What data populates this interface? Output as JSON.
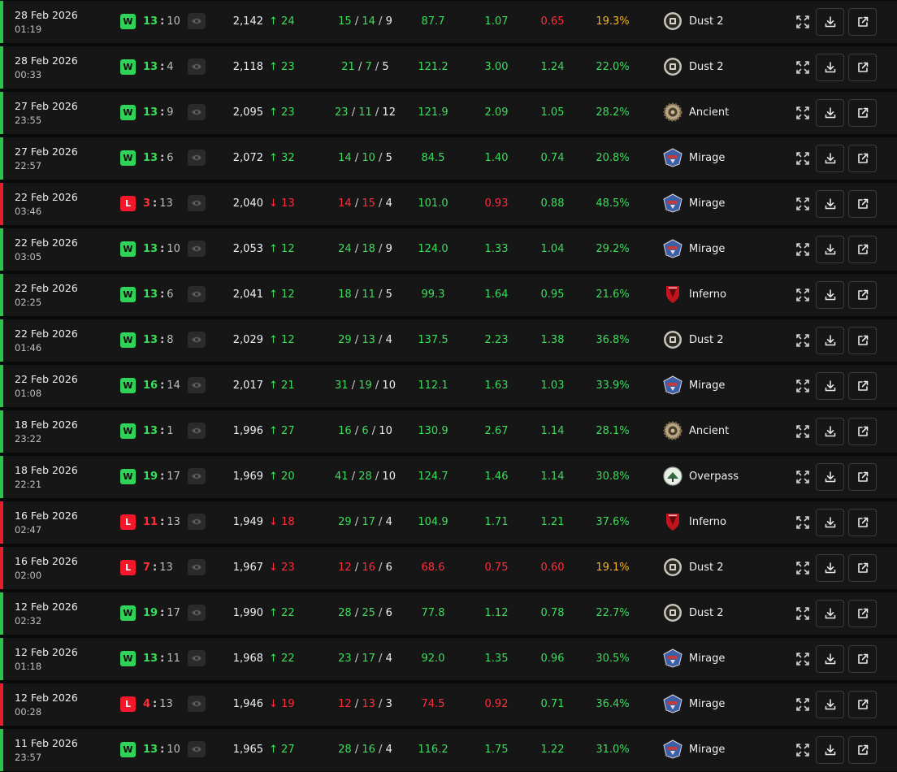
{
  "colors": {
    "win": "#2cc34c",
    "loss": "#e5202c",
    "green_text": "#3ddc5c",
    "red_text": "#ff2d3a",
    "yellow_text": "#f5b51e"
  },
  "matches": [
    {
      "date": "28 Feb 2026",
      "time": "01:19",
      "result": "W",
      "own": "13",
      "opp": "10",
      "elo": "2,142",
      "dir": "up",
      "change": "24",
      "kills": "15",
      "deaths": "14",
      "assists": "9",
      "kda_color": "green",
      "adr": "87.7",
      "adr_color": "green",
      "kd": "1.07",
      "kd_color": "green",
      "kr": "0.65",
      "kr_color": "red",
      "hs": "19.3%",
      "hs_color": "yellow",
      "map": "Dust 2",
      "map_icon": "dust2-icon"
    },
    {
      "date": "28 Feb 2026",
      "time": "00:33",
      "result": "W",
      "own": "13",
      "opp": "4",
      "elo": "2,118",
      "dir": "up",
      "change": "23",
      "kills": "21",
      "deaths": "7",
      "assists": "5",
      "kda_color": "green",
      "adr": "121.2",
      "adr_color": "green",
      "kd": "3.00",
      "kd_color": "green",
      "kr": "1.24",
      "kr_color": "green",
      "hs": "22.0%",
      "hs_color": "green",
      "map": "Dust 2",
      "map_icon": "dust2-icon"
    },
    {
      "date": "27 Feb 2026",
      "time": "23:55",
      "result": "W",
      "own": "13",
      "opp": "9",
      "elo": "2,095",
      "dir": "up",
      "change": "23",
      "kills": "23",
      "deaths": "11",
      "assists": "12",
      "kda_color": "green",
      "adr": "121.9",
      "adr_color": "green",
      "kd": "2.09",
      "kd_color": "green",
      "kr": "1.05",
      "kr_color": "green",
      "hs": "28.2%",
      "hs_color": "green",
      "map": "Ancient",
      "map_icon": "ancient-icon"
    },
    {
      "date": "27 Feb 2026",
      "time": "22:57",
      "result": "W",
      "own": "13",
      "opp": "6",
      "elo": "2,072",
      "dir": "up",
      "change": "32",
      "kills": "14",
      "deaths": "10",
      "assists": "5",
      "kda_color": "green",
      "adr": "84.5",
      "adr_color": "green",
      "kd": "1.40",
      "kd_color": "green",
      "kr": "0.74",
      "kr_color": "green",
      "hs": "20.8%",
      "hs_color": "green",
      "map": "Mirage",
      "map_icon": "mirage-icon"
    },
    {
      "date": "22 Feb 2026",
      "time": "03:46",
      "result": "L",
      "own": "3",
      "opp": "13",
      "elo": "2,040",
      "dir": "down",
      "change": "13",
      "kills": "14",
      "deaths": "15",
      "assists": "4",
      "kda_color": "red",
      "adr": "101.0",
      "adr_color": "green",
      "kd": "0.93",
      "kd_color": "red",
      "kr": "0.88",
      "kr_color": "green",
      "hs": "48.5%",
      "hs_color": "green",
      "map": "Mirage",
      "map_icon": "mirage-icon"
    },
    {
      "date": "22 Feb 2026",
      "time": "03:05",
      "result": "W",
      "own": "13",
      "opp": "10",
      "elo": "2,053",
      "dir": "up",
      "change": "12",
      "kills": "24",
      "deaths": "18",
      "assists": "9",
      "kda_color": "green",
      "adr": "124.0",
      "adr_color": "green",
      "kd": "1.33",
      "kd_color": "green",
      "kr": "1.04",
      "kr_color": "green",
      "hs": "29.2%",
      "hs_color": "green",
      "map": "Mirage",
      "map_icon": "mirage-icon"
    },
    {
      "date": "22 Feb 2026",
      "time": "02:25",
      "result": "W",
      "own": "13",
      "opp": "6",
      "elo": "2,041",
      "dir": "up",
      "change": "12",
      "kills": "18",
      "deaths": "11",
      "assists": "5",
      "kda_color": "green",
      "adr": "99.3",
      "adr_color": "green",
      "kd": "1.64",
      "kd_color": "green",
      "kr": "0.95",
      "kr_color": "green",
      "hs": "21.6%",
      "hs_color": "green",
      "map": "Inferno",
      "map_icon": "inferno-icon"
    },
    {
      "date": "22 Feb 2026",
      "time": "01:46",
      "result": "W",
      "own": "13",
      "opp": "8",
      "elo": "2,029",
      "dir": "up",
      "change": "12",
      "kills": "29",
      "deaths": "13",
      "assists": "4",
      "kda_color": "green",
      "adr": "137.5",
      "adr_color": "green",
      "kd": "2.23",
      "kd_color": "green",
      "kr": "1.38",
      "kr_color": "green",
      "hs": "36.8%",
      "hs_color": "green",
      "map": "Dust 2",
      "map_icon": "dust2-icon"
    },
    {
      "date": "22 Feb 2026",
      "time": "01:08",
      "result": "W",
      "own": "16",
      "opp": "14",
      "elo": "2,017",
      "dir": "up",
      "change": "21",
      "kills": "31",
      "deaths": "19",
      "assists": "10",
      "kda_color": "green",
      "adr": "112.1",
      "adr_color": "green",
      "kd": "1.63",
      "kd_color": "green",
      "kr": "1.03",
      "kr_color": "green",
      "hs": "33.9%",
      "hs_color": "green",
      "map": "Mirage",
      "map_icon": "mirage-icon"
    },
    {
      "date": "18 Feb 2026",
      "time": "23:22",
      "result": "W",
      "own": "13",
      "opp": "1",
      "elo": "1,996",
      "dir": "up",
      "change": "27",
      "kills": "16",
      "deaths": "6",
      "assists": "10",
      "kda_color": "green",
      "adr": "130.9",
      "adr_color": "green",
      "kd": "2.67",
      "kd_color": "green",
      "kr": "1.14",
      "kr_color": "green",
      "hs": "28.1%",
      "hs_color": "green",
      "map": "Ancient",
      "map_icon": "ancient-icon"
    },
    {
      "date": "18 Feb 2026",
      "time": "22:21",
      "result": "W",
      "own": "19",
      "opp": "17",
      "elo": "1,969",
      "dir": "up",
      "change": "20",
      "kills": "41",
      "deaths": "28",
      "assists": "10",
      "kda_color": "green",
      "adr": "124.7",
      "adr_color": "green",
      "kd": "1.46",
      "kd_color": "green",
      "kr": "1.14",
      "kr_color": "green",
      "hs": "30.8%",
      "hs_color": "green",
      "map": "Overpass",
      "map_icon": "overpass-icon"
    },
    {
      "date": "16 Feb 2026",
      "time": "02:47",
      "result": "L",
      "own": "11",
      "opp": "13",
      "elo": "1,949",
      "dir": "down",
      "change": "18",
      "kills": "29",
      "deaths": "17",
      "assists": "4",
      "kda_color": "green",
      "adr": "104.9",
      "adr_color": "green",
      "kd": "1.71",
      "kd_color": "green",
      "kr": "1.21",
      "kr_color": "green",
      "hs": "37.6%",
      "hs_color": "green",
      "map": "Inferno",
      "map_icon": "inferno-icon"
    },
    {
      "date": "16 Feb 2026",
      "time": "02:00",
      "result": "L",
      "own": "7",
      "opp": "13",
      "elo": "1,967",
      "dir": "down",
      "change": "23",
      "kills": "12",
      "deaths": "16",
      "assists": "6",
      "kda_color": "red",
      "adr": "68.6",
      "adr_color": "red",
      "kd": "0.75",
      "kd_color": "red",
      "kr": "0.60",
      "kr_color": "red",
      "hs": "19.1%",
      "hs_color": "yellow",
      "map": "Dust 2",
      "map_icon": "dust2-icon"
    },
    {
      "date": "12 Feb 2026",
      "time": "02:32",
      "result": "W",
      "own": "19",
      "opp": "17",
      "elo": "1,990",
      "dir": "up",
      "change": "22",
      "kills": "28",
      "deaths": "25",
      "assists": "6",
      "kda_color": "green",
      "adr": "77.8",
      "adr_color": "green",
      "kd": "1.12",
      "kd_color": "green",
      "kr": "0.78",
      "kr_color": "green",
      "hs": "22.7%",
      "hs_color": "green",
      "map": "Dust 2",
      "map_icon": "dust2-icon"
    },
    {
      "date": "12 Feb 2026",
      "time": "01:18",
      "result": "W",
      "own": "13",
      "opp": "11",
      "elo": "1,968",
      "dir": "up",
      "change": "22",
      "kills": "23",
      "deaths": "17",
      "assists": "4",
      "kda_color": "green",
      "adr": "92.0",
      "adr_color": "green",
      "kd": "1.35",
      "kd_color": "green",
      "kr": "0.96",
      "kr_color": "green",
      "hs": "30.5%",
      "hs_color": "green",
      "map": "Mirage",
      "map_icon": "mirage-icon"
    },
    {
      "date": "12 Feb 2026",
      "time": "00:28",
      "result": "L",
      "own": "4",
      "opp": "13",
      "elo": "1,946",
      "dir": "down",
      "change": "19",
      "kills": "12",
      "deaths": "13",
      "assists": "3",
      "kda_color": "red",
      "adr": "74.5",
      "adr_color": "red",
      "kd": "0.92",
      "kd_color": "red",
      "kr": "0.71",
      "kr_color": "green",
      "hs": "36.4%",
      "hs_color": "green",
      "map": "Mirage",
      "map_icon": "mirage-icon"
    },
    {
      "date": "11 Feb 2026",
      "time": "23:57",
      "result": "W",
      "own": "13",
      "opp": "10",
      "elo": "1,965",
      "dir": "up",
      "change": "27",
      "kills": "28",
      "deaths": "16",
      "assists": "4",
      "kda_color": "green",
      "adr": "116.2",
      "adr_color": "green",
      "kd": "1.75",
      "kd_color": "green",
      "kr": "1.22",
      "kr_color": "green",
      "hs": "31.0%",
      "hs_color": "green",
      "map": "Mirage",
      "map_icon": "mirage-icon"
    }
  ]
}
